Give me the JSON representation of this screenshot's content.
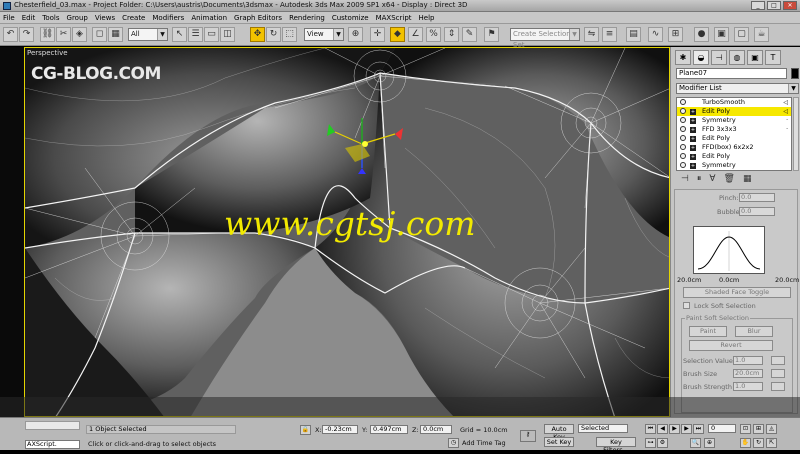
{
  "window": {
    "title": "Chesterfield_03.max    - Project Folder: C:\\Users\\austris\\Documents\\3dsmax    - Autodesk 3ds Max  2009 SP1  x64       - Display : Direct 3D",
    "controls": [
      "_",
      "□",
      "✕"
    ]
  },
  "menu": {
    "items": [
      "File",
      "Edit",
      "Tools",
      "Group",
      "Views",
      "Create",
      "Modifiers",
      "Animation",
      "Graph Editors",
      "Rendering",
      "Customize",
      "MAXScript",
      "Help"
    ]
  },
  "toolbar": {
    "selection_filter": "All",
    "reference_coord": "View",
    "named_selection_placeholder": "Create Selection Set",
    "icons": [
      "undo-icon",
      "redo-icon",
      "link-icon",
      "unlink-icon",
      "bind-icon",
      "filter-icon",
      "select-icon",
      "select-name-icon",
      "rect-select-icon",
      "window-crossing-icon",
      "move-icon",
      "rotate-icon",
      "scale-icon",
      "pivot-icon",
      "select-manip-icon",
      "snap-icon",
      "angle-snap-icon",
      "percent-snap-icon",
      "spinner-snap-icon",
      "mirror-icon",
      "align-icon",
      "layer-icon",
      "curve-editor-icon",
      "schematic-icon",
      "material-icon",
      "render-setup-icon",
      "render-frame-icon",
      "render-icon"
    ]
  },
  "viewport": {
    "label": "Perspective",
    "logo": "CG-BLOG.COM",
    "watermark": "www.cgtsj.com",
    "colors": {
      "border": "#e3d400",
      "watermark": "#f2ea00",
      "wire": "#f4f4f4",
      "background": "#5e5e5e"
    }
  },
  "command_panel": {
    "object_name": "Plane07",
    "modifier_list": "Modifier List",
    "stack": [
      {
        "label": "TurboSmooth",
        "selected": false,
        "has_box": false,
        "suffix": "◁"
      },
      {
        "label": "Edit Poly",
        "selected": true,
        "has_box": true,
        "suffix": "◁"
      },
      {
        "label": "Symmetry",
        "selected": false,
        "has_box": true,
        "suffix": "·"
      },
      {
        "label": "FFD 3x3x3",
        "selected": false,
        "has_box": true,
        "suffix": "·"
      },
      {
        "label": "Edit Poly",
        "selected": false,
        "has_box": true,
        "suffix": ""
      },
      {
        "label": "FFD(box) 6x2x2",
        "selected": false,
        "has_box": true,
        "suffix": ""
      },
      {
        "label": "Edit Poly",
        "selected": false,
        "has_box": true,
        "suffix": ""
      },
      {
        "label": "Symmetry",
        "selected": false,
        "has_box": true,
        "suffix": ""
      }
    ],
    "soft_selection": {
      "pinch_label": "Pinch:",
      "pinch_value": "0.0",
      "bubble_label": "Bubble:",
      "bubble_value": "0.0",
      "curve_left": "20.0cm",
      "curve_mid": "0.0cm",
      "curve_right": "20.0cm",
      "shaded_face_toggle": "Shaded Face Toggle",
      "lock_soft_selection": "Lock Soft Selection"
    },
    "paint_soft_selection": {
      "group_label": "Paint Soft Selection",
      "paint": "Paint",
      "blur": "Blur",
      "revert": "Revert",
      "selection_value_label": "Selection Value",
      "selection_value": "1.0",
      "brush_size_label": "Brush Size",
      "brush_size": "20.0cm",
      "brush_strength_label": "Brush Strength",
      "brush_strength": "1.0"
    }
  },
  "status": {
    "maxscript_label": "AXScript.",
    "objects_selected": "1 Object Selected",
    "prompt": "Click or click-and-drag to select objects",
    "x_label": "X:",
    "x_value": "-0.23cm",
    "y_label": "Y:",
    "y_value": "0.497cm",
    "z_label": "Z:",
    "z_value": "0.0cm",
    "grid": "Grid = 10.0cm",
    "add_time_tag": "Add Time Tag",
    "auto_key": "Auto Key",
    "set_key": "Set Key",
    "key_mode": "Selected",
    "key_filters": "Key Filters...",
    "frame": "0"
  }
}
